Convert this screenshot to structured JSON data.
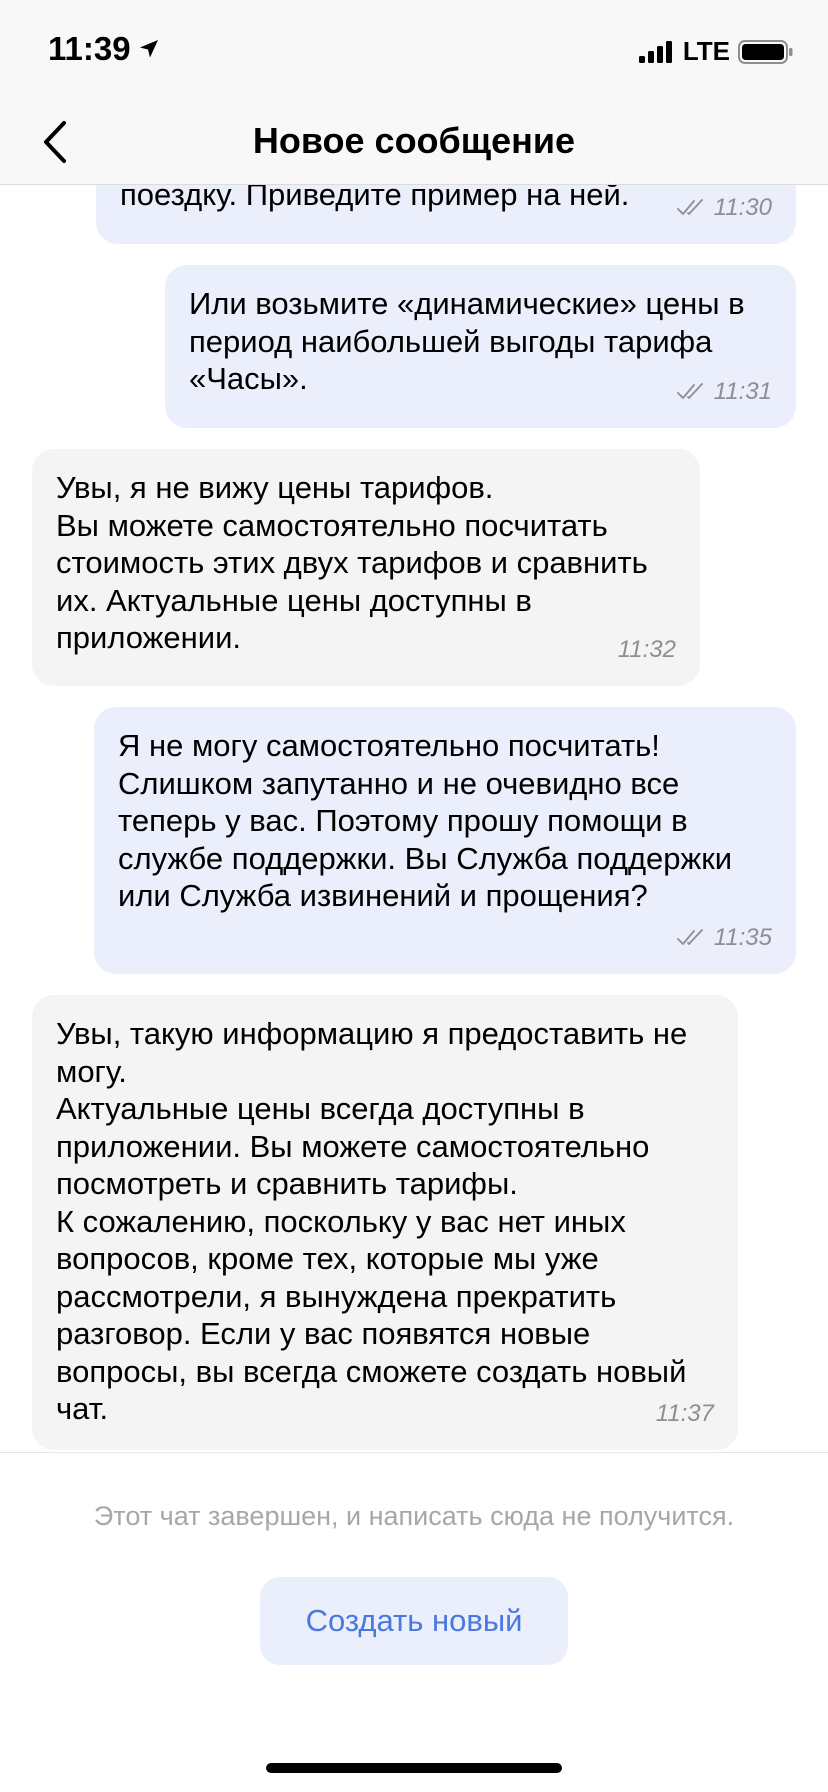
{
  "status_bar": {
    "time": "11:39",
    "network": "LTE"
  },
  "header": {
    "title": "Новое сообщение",
    "back_icon": "chevron-left-icon"
  },
  "messages": [
    {
      "direction": "outgoing",
      "text": "поездку. Приведите пример на ней.",
      "time": "11:30",
      "read": true
    },
    {
      "direction": "outgoing",
      "text": "Или возьмите «динамические» цены в\nпериод наибольшей выгоды тарифа\n«Часы».",
      "time": "11:31",
      "read": true
    },
    {
      "direction": "incoming",
      "text": "Увы, я не вижу цены тарифов.\nВы можете самостоятельно посчитать\nстоимость этих двух тарифов и сравнить\nих. Актуальные цены доступны в\nприложении.",
      "time": "11:32"
    },
    {
      "direction": "outgoing",
      "text": "Я не могу самостоятельно посчитать!\nСлишком запутанно и не очевидно все\nтеперь у вас. Поэтому прошу помощи в\nслужбе поддержки. Вы Служба поддержки\nили Служба извинений и прощения?",
      "time": "11:35",
      "read": true
    },
    {
      "direction": "incoming",
      "text": "Увы, такую информацию я предоставить не\nмогу.\nАктуальные цены всегда доступны в\nприложении. Вы можете самостоятельно\nпосмотреть и сравнить тарифы.\nК сожалению, поскольку у вас нет иных\nвопросов, кроме тех, которые мы уже\nрассмотрели, я вынуждена прекратить\nразговор. Если у вас появятся новые\nвопросы, вы всегда сможете создать новый\nчат.",
      "time": "11:37"
    }
  ],
  "footer": {
    "closed_note": "Этот чат завершен, и написать сюда не получится.",
    "create_button_label": "Создать новый"
  },
  "colors": {
    "outgoing_bubble": "#ebeefb",
    "incoming_bubble": "#f4f4f4",
    "accent": "#4a78dd",
    "muted_text": "#a7a7ab"
  }
}
